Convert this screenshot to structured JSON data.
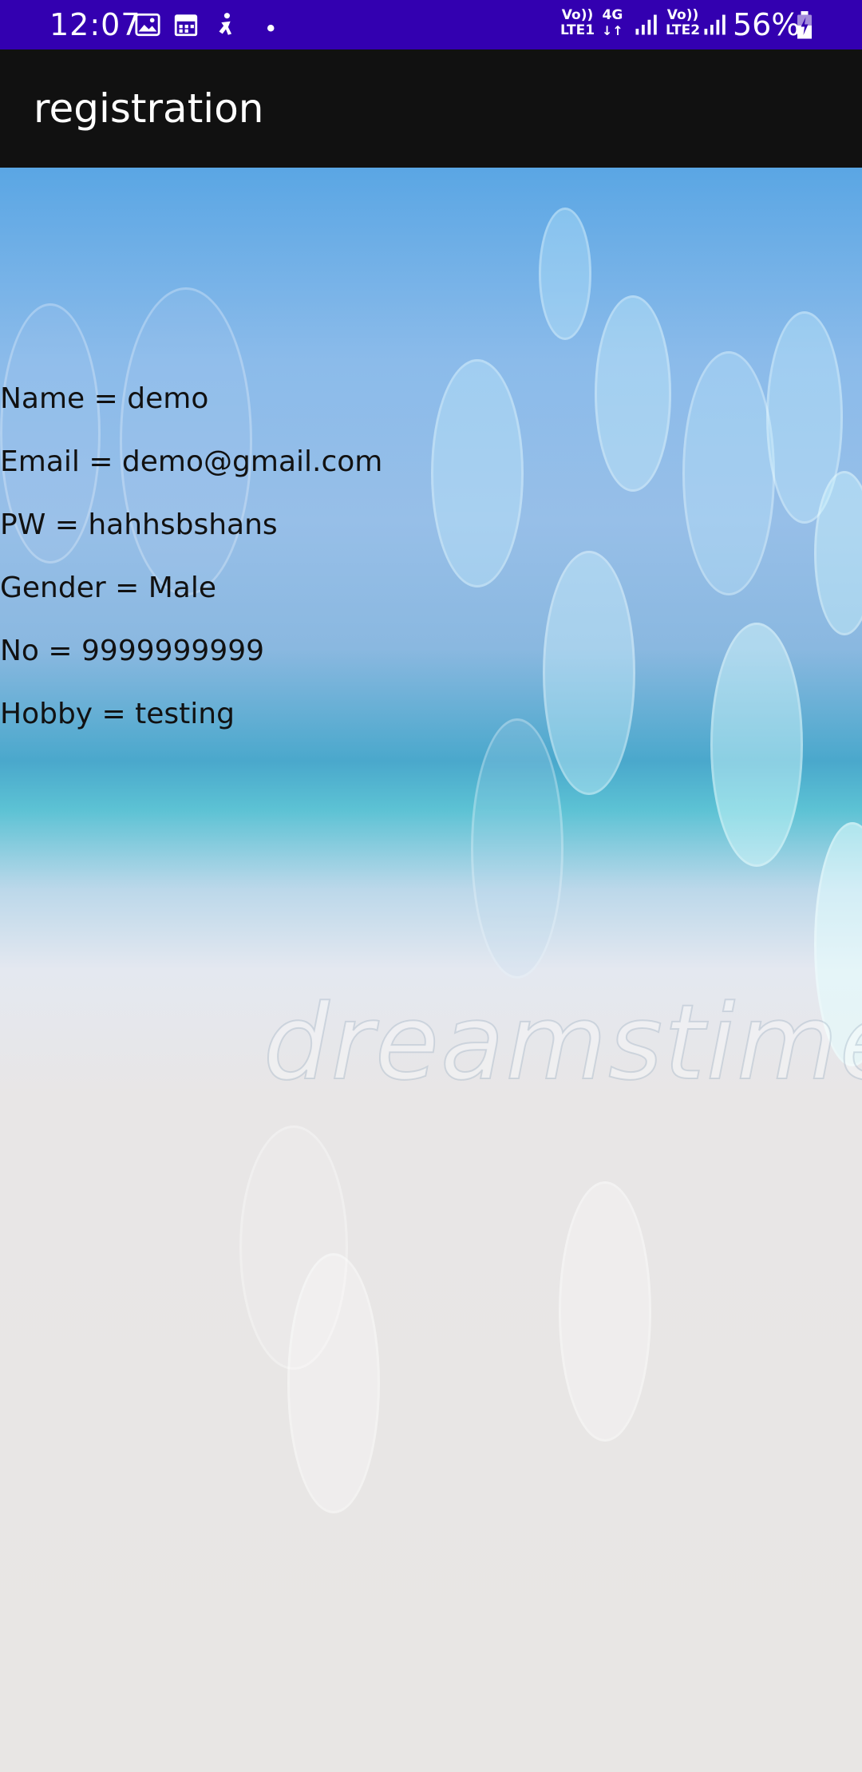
{
  "status_bar": {
    "time": "12:07",
    "icons": [
      "image-icon",
      "calendar-icon",
      "accessibility-icon",
      "dot-icon"
    ],
    "sim1_label": "Vo))",
    "sim1_net": "LTE1",
    "net_type": "4G",
    "sim2_label": "Vo))",
    "sim2_net": "LTE2",
    "battery": "56%"
  },
  "app_bar": {
    "title": "registration"
  },
  "details": {
    "name": "Name = demo",
    "email": "Email = demo@gmail.com",
    "password": "PW = hahhsbshans",
    "gender": "Gender = Male",
    "number": "No = 9999999999",
    "hobby": "Hobby = testing"
  },
  "background": {
    "watermark": "dreamstime."
  },
  "colors": {
    "status_bar": "#3300b0",
    "app_bar": "#111111",
    "text": "#111111"
  }
}
